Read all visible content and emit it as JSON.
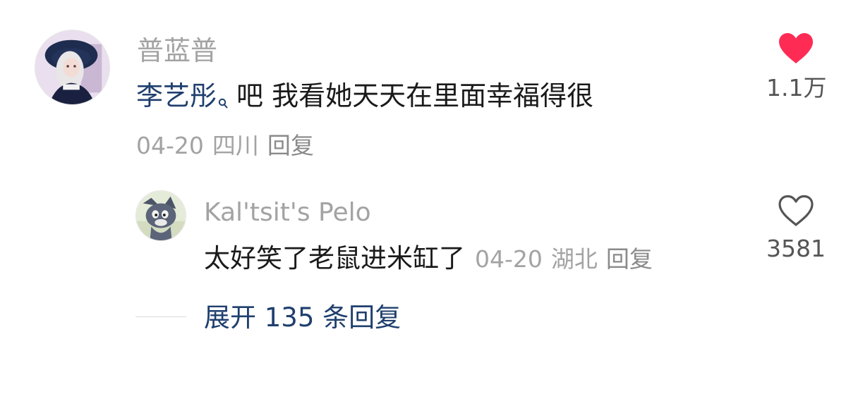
{
  "comments": [
    {
      "username": "普蓝普",
      "mention": "李艺彤",
      "text": "吧  我看她天天在里面幸福得很",
      "date": "04-20",
      "region": "四川",
      "reply_label": "回复",
      "likes": "1.1万",
      "liked": true,
      "avatar_icon": "gothic-lolita-portrait"
    },
    {
      "username": "Kal'tsit's Pelo",
      "text": "太好笑了老鼠进米缸了",
      "date": "04-20",
      "region": "湖北",
      "reply_label": "回复",
      "likes": "3581",
      "liked": false,
      "avatar_icon": "cartoon-cat-portrait"
    }
  ],
  "expand_replies": "展开 135 条回复",
  "colors": {
    "accent_link": "#1f3f6e",
    "liked_heart": "#fe2c55",
    "muted_text": "#a3a3a3",
    "body_text": "#1a1a1a"
  }
}
